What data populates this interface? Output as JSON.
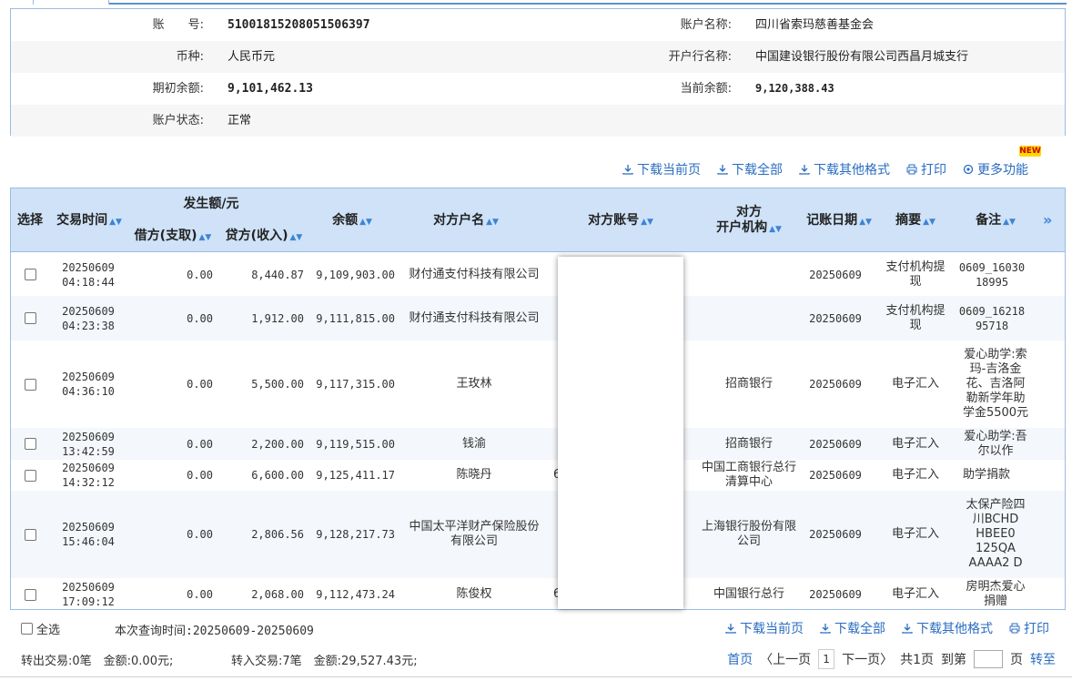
{
  "account_info": {
    "rows": [
      {
        "label": "账　　号:",
        "value": "51001815208051506397",
        "label2": "账户名称:",
        "value2": "四川省索玛慈善基金会"
      },
      {
        "label": "币种:",
        "value": "人民币元",
        "label2": "开户行名称:",
        "value2": "中国建设银行股份有限公司西昌月城支行"
      },
      {
        "label": "期初余额:",
        "value": "9,101,462.13",
        "label2": "当前余额:",
        "value2": "9,120,388.43"
      },
      {
        "label": "账户状态:",
        "value": "正常",
        "label2": "",
        "value2": ""
      }
    ]
  },
  "toolbar": {
    "download_page": "下载当前页",
    "download_all": "下载全部",
    "download_other": "下载其他格式",
    "print": "打印",
    "more": "更多功能",
    "new_badge": "NEW"
  },
  "table": {
    "headers": {
      "select": "选择",
      "time": "交易时间",
      "amount_group": "发生额/元",
      "debit": "借方(支取)",
      "credit": "贷方(收入)",
      "balance": "余额",
      "cp_name": "对方户名",
      "cp_account": "对方账号",
      "cp_bank_1": "对方",
      "cp_bank_2": "开户机构",
      "book_date": "记账日期",
      "summary": "摘要",
      "note": "备注",
      "expand": "»"
    },
    "rows": [
      {
        "date": "20250609",
        "time": "04:18:44",
        "debit": "0.00",
        "credit": "8,440.87",
        "balance": "9,109,903.00",
        "cp_name": "财付通支付科技有限公司",
        "cp_account": "",
        "cp_bank": "",
        "book_date": "20250609",
        "summary": "支付机构提现",
        "note": "0609_16030 18995"
      },
      {
        "date": "20250609",
        "time": "04:23:38",
        "debit": "0.00",
        "credit": "1,912.00",
        "balance": "9,111,815.00",
        "cp_name": "财付通支付科技有限公司",
        "cp_account": "",
        "cp_bank": "",
        "book_date": "20250609",
        "summary": "支付机构提现",
        "note": "0609_16218 95718"
      },
      {
        "date": "20250609",
        "time": "04:36:10",
        "debit": "0.00",
        "credit": "5,500.00",
        "balance": "9,117,315.00",
        "cp_name": "王玫林",
        "cp_account": "",
        "cp_bank": "招商银行",
        "book_date": "20250609",
        "summary": "电子汇入",
        "note": "爱心助学:索玛-吉洛金花、吉洛阿勒新学年助学金5500元"
      },
      {
        "date": "20250609",
        "time": "13:42:59",
        "debit": "0.00",
        "credit": "2,200.00",
        "balance": "9,119,515.00",
        "cp_name": "钱渝",
        "cp_account": "",
        "cp_bank": "招商银行",
        "book_date": "20250609",
        "summary": "电子汇入",
        "note": "爱心助学:吾尔以作"
      },
      {
        "date": "20250609",
        "time": "14:32:12",
        "debit": "0.00",
        "credit": "6,600.00",
        "balance": "9,125,411.17",
        "cp_name": "陈晓丹",
        "cp_account": "6",
        "cp_bank": "中国工商银行总行清算中心",
        "book_date": "20250609",
        "summary": "电子汇入",
        "note": "助学捐款"
      },
      {
        "date": "20250609",
        "time": "15:46:04",
        "debit": "0.00",
        "credit": "2,806.56",
        "balance": "9,128,217.73",
        "cp_name": "中国太平洋财产保险股份有限公司",
        "cp_account": "",
        "cp_bank": "上海银行股份有限公司",
        "book_date": "20250609",
        "summary": "电子汇入",
        "note": "太保产险四川BCHD HBEE0 125QA AAAA2 D"
      },
      {
        "date": "20250609",
        "time": "17:09:12",
        "debit": "0.00",
        "credit": "2,068.00",
        "balance": "9,112,473.24",
        "cp_name": "陈俊权",
        "cp_account": "6",
        "cp_bank": "中国银行总行",
        "book_date": "20250609",
        "summary": "电子汇入",
        "note": "房明杰爱心捐赠"
      }
    ]
  },
  "footer": {
    "select_all": "全选",
    "query_time": "本次查询时间:20250609-20250609",
    "out_summary": "转出交易:0笔　金额:0.00元;",
    "in_summary": "转入交易:7笔　金额:29,527.43元;",
    "pager": {
      "first": "首页",
      "prev": "〈上一页",
      "current": "1",
      "next": "下一页〉",
      "total": "共1页",
      "goto_label": "到第",
      "page_unit": "页",
      "go": "转至"
    }
  }
}
